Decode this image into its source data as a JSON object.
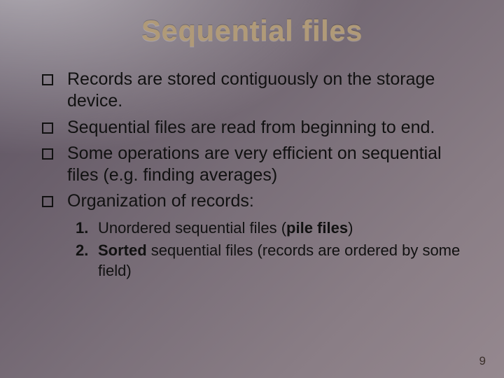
{
  "title": "Sequential files",
  "bullets": [
    "Records are stored contiguously on the storage device.",
    "Sequential files are read from beginning to end.",
    "Some operations are very efficient on sequential files (e.g. finding averages)",
    "Organization of records:"
  ],
  "sublist": [
    {
      "pre": "Unordered sequential files (",
      "bold": "pile files",
      "post": ")"
    },
    {
      "pre": "",
      "bold": "Sorted",
      "post": " sequential files (records are ordered by some field)"
    }
  ],
  "page_number": "9"
}
